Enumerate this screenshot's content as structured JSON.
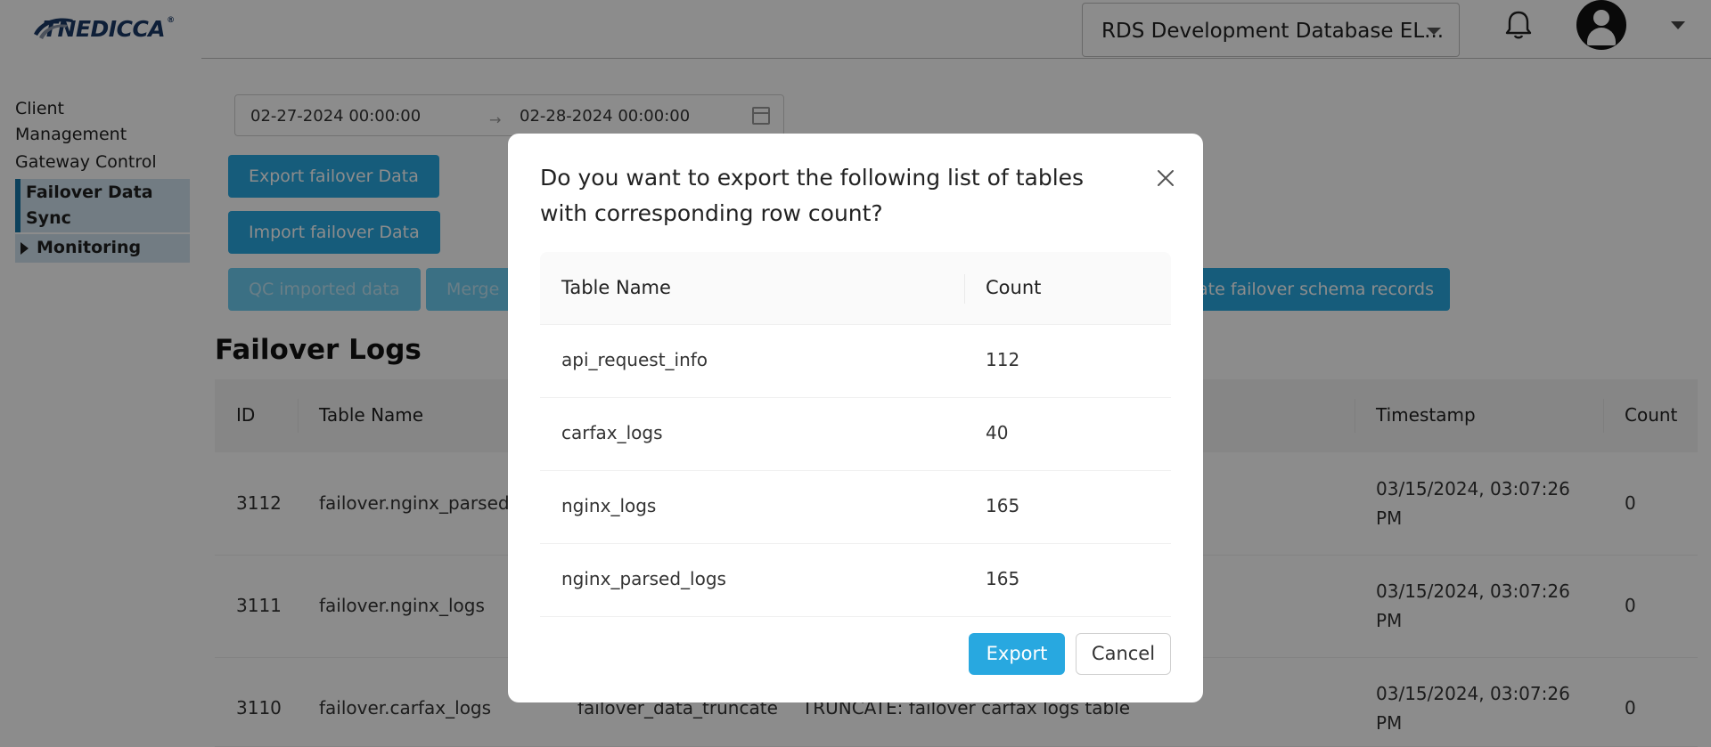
{
  "header": {
    "logo_text": "TNEDICCA",
    "logo_reg": "®",
    "db_selector": "RDS Development Database EL..."
  },
  "sidebar": {
    "items": [
      {
        "label": "Client"
      },
      {
        "label": "Management"
      },
      {
        "label": "Gateway Control"
      },
      {
        "label": "Failover Data"
      },
      {
        "label": "Sync"
      },
      {
        "label": "Monitoring"
      }
    ]
  },
  "filters": {
    "start_date": "02-27-2024 00:00:00",
    "end_date": "02-28-2024 00:00:00",
    "arrow": "→"
  },
  "buttons": {
    "export_failover": "Export failover Data",
    "import_failover": "Import failover Data",
    "qc_imported": "QC imported data",
    "merge": "Merge",
    "update_schema": "ate failover schema records"
  },
  "logs": {
    "title": "Failover Logs",
    "columns": [
      "ID",
      "Table Name",
      "Timestamp",
      "Count"
    ],
    "rows": [
      {
        "id": "3112",
        "table": "failover.nginx_parsed_lo",
        "action": "",
        "description": "",
        "timestamp_line1": "03/15/2024, 03:07:26",
        "timestamp_line2": "PM",
        "count": "0"
      },
      {
        "id": "3111",
        "table": "failover.nginx_logs",
        "action": "",
        "description": "",
        "timestamp_line1": "03/15/2024, 03:07:26",
        "timestamp_line2": "PM",
        "count": "0"
      },
      {
        "id": "3110",
        "table": "failover.carfax_logs",
        "action": "failover_data_truncate",
        "description": "TRUNCATE: failover carfax logs table",
        "timestamp_line1": "03/15/2024, 03:07:26",
        "timestamp_line2": "PM",
        "count": "0"
      }
    ]
  },
  "modal": {
    "title": "Do you want to export the following list of tables with corresponding row count?",
    "col_table": "Table Name",
    "col_count": "Count",
    "rows": [
      {
        "table": "api_request_info",
        "count": "112"
      },
      {
        "table": "carfax_logs",
        "count": "40"
      },
      {
        "table": "nginx_logs",
        "count": "165"
      },
      {
        "table": "nginx_parsed_logs",
        "count": "165"
      }
    ],
    "export_label": "Export",
    "cancel_label": "Cancel"
  },
  "colors": {
    "primary": "#28a8e0",
    "overlay": "rgba(0,0,0,0.45)",
    "sidebar_active": "#cfe2ee"
  }
}
